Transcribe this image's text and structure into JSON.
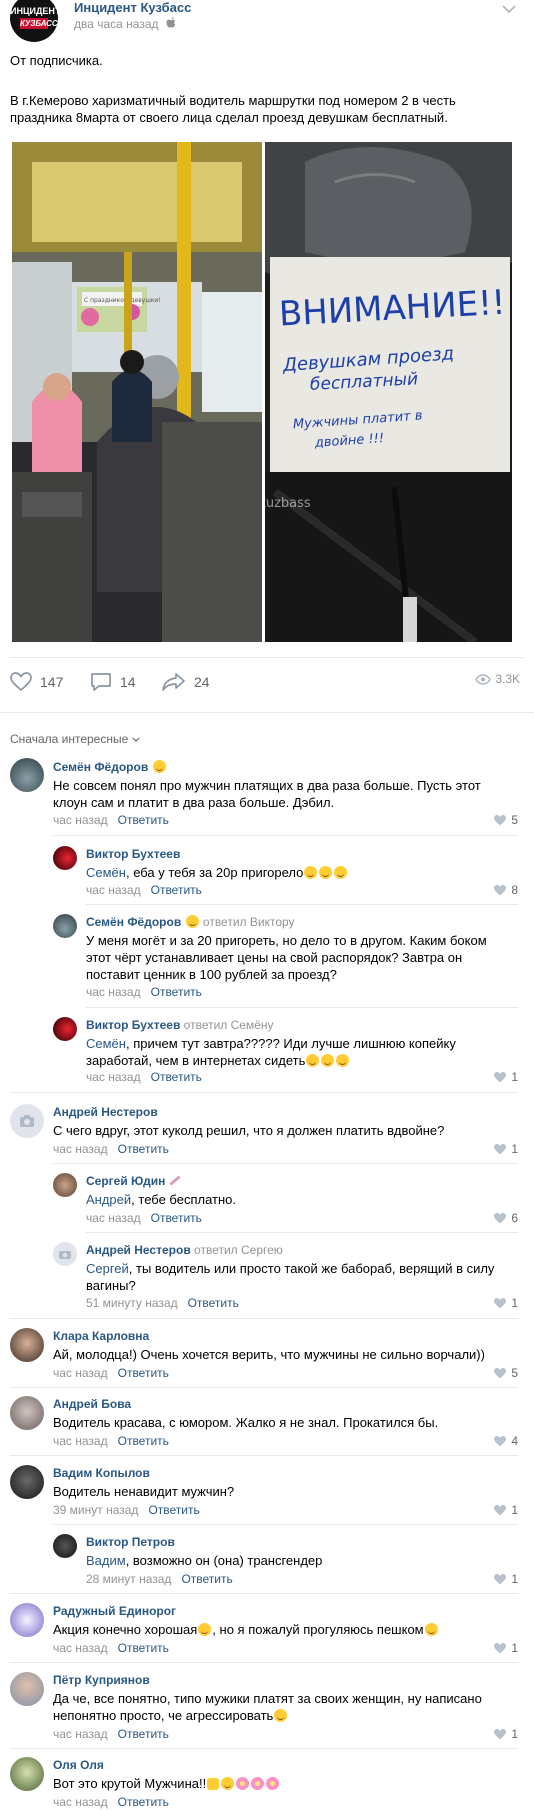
{
  "post": {
    "author": "Инцидент Кузбасс",
    "logo_top": "ИНЦИДЕНТ",
    "logo_bottom": "КУЗБАСС",
    "time": "два часа назад",
    "text1": "От подписчика.",
    "text2": "В г.Кемерово харизматичный водитель маршрутки под номером 2 в честь праздника 8марта от своего лица сделал проезд девушкам бесплатный.",
    "sign_l1": "ВНИМАНИЕ!!",
    "sign_l2": "Девушкам проезд",
    "sign_l3": "бесплатный",
    "sign_l4": "Мужчины платит в",
    "sign_l5": "двойне !!!",
    "watermark": "@incident_kuzbass",
    "bus_banner": "С праздником девушки!"
  },
  "stats": {
    "likes": "147",
    "comments": "14",
    "shares": "24",
    "views": "3.3K"
  },
  "sort_label": "Сначала интересные",
  "reply_label": "Ответить",
  "comments": [
    {
      "name": "Семён Фёдоров",
      "text": "Не совсем понял про мужчин платящих в два раза больше. Пусть этот клоун сам и платит в два раза больше. Дэбил.",
      "time": "час назад",
      "likes": "5"
    },
    {
      "name": "Виктор Бухтеев",
      "who": "Семён",
      "text": ", еба у тебя за 20р пригорело",
      "time": "час назад",
      "likes": "8"
    },
    {
      "name": "Семён Фёдоров",
      "replied": "ответил Виктору",
      "text": "У меня могёт и за 20 пригореть, но дело то в другом. Каким боком этот чёрт устанавливает цены на свой распорядок? Завтра он поставит ценник в 100 рублей за проезд?",
      "time": "час назад",
      "likes": ""
    },
    {
      "name": "Виктор Бухтеев",
      "replied": "ответил Семёну",
      "who": "Семён",
      "text": ", причем тут завтра????? Иди лучше лишнюю копейку заработай, чем в интернетах сидеть",
      "time": "час назад",
      "likes": "1"
    },
    {
      "name": "Андрей Нестеров",
      "text": "С чего вдруг, этот куколд решил, что я должен платить вдвойне?",
      "time": "час назад",
      "likes": "1"
    },
    {
      "name": "Сергей Юдин",
      "who": "Андрей",
      "text": ", тебе бесплатно.",
      "time": "час назад",
      "likes": "6"
    },
    {
      "name": "Андрей Нестеров",
      "replied": "ответил Сергею",
      "who": "Сергей",
      "text": ", ты водитель или просто такой же бабораб, верящий в силу вагины?",
      "time": "51 минуту назад",
      "likes": "1"
    },
    {
      "name": "Клара Карловна",
      "text": "Ай, молодца!) Очень хочется верить, что мужчины не сильно ворчали))",
      "time": "час назад",
      "likes": "5"
    },
    {
      "name": "Андрей Бова",
      "text": "Водитель красава, с юмором. Жалко я не знал. Прокатился бы.",
      "time": "час назад",
      "likes": "4"
    },
    {
      "name": "Вадим Копылов",
      "text": "Водитель ненавидит мужчин?",
      "time": "39 минут назад",
      "likes": "1"
    },
    {
      "name": "Виктор Петров",
      "who": "Вадим",
      "text": ", возможно он (она) трансгендер",
      "time": "28 минут назад",
      "likes": "1"
    },
    {
      "name": "Радужный Единорог",
      "text_a": "Акция конечно хорошая",
      "text_b": ", но я пожалуй прогуляюсь пешком",
      "time": "час назад",
      "likes": "1"
    },
    {
      "name": "Пётр Куприянов",
      "text": "Да че, все понятно, типо мужики платят за своих женщин, ну написано непонятно просто, че агрессировать",
      "time": "час назад",
      "likes": "1"
    },
    {
      "name": "Оля Оля",
      "text": "Вот это крутой Мужчина!!",
      "time": "час назад",
      "likes": ""
    }
  ]
}
